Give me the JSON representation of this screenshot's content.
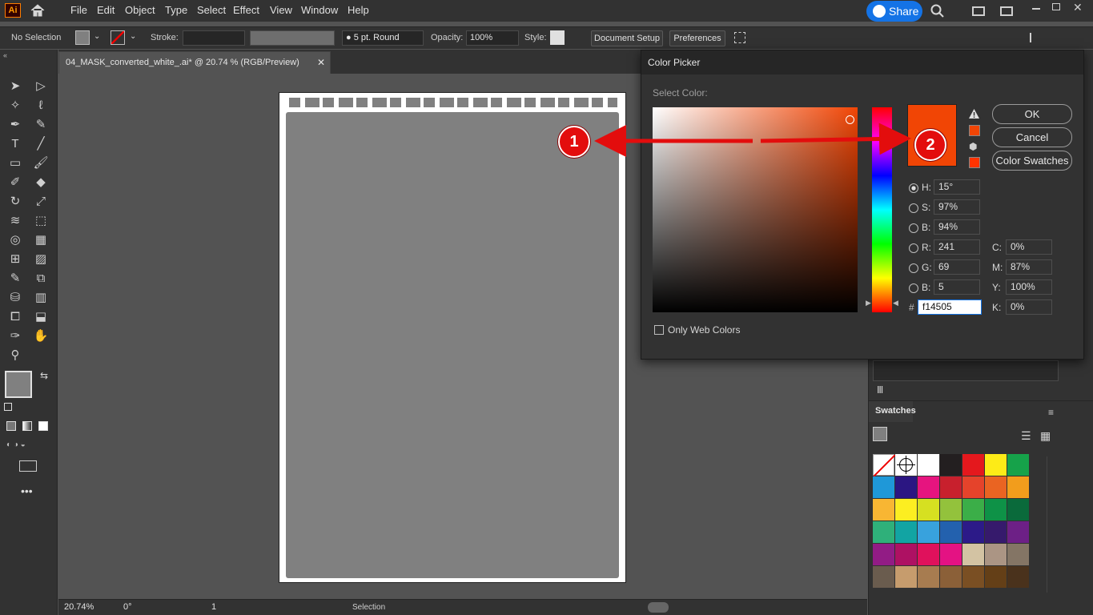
{
  "app": {
    "logo": "Ai",
    "share_label": "Share"
  },
  "menu": [
    "File",
    "Edit",
    "Object",
    "Type",
    "Select",
    "Effect",
    "View",
    "Window",
    "Help"
  ],
  "control": {
    "selection": "No Selection",
    "stroke_label": "Stroke:",
    "brush": "5 pt. Round",
    "opacity_label": "Opacity:",
    "opacity": "100%",
    "style_label": "Style:",
    "document_setup": "Document Setup",
    "preferences": "Preferences"
  },
  "document": {
    "tab_title": "04_MASK_converted_white_.ai* @ 20.74 % (RGB/Preview)"
  },
  "status": {
    "zoom": "20.74%",
    "rotation": "0°",
    "artboard": "1",
    "mode": "Selection"
  },
  "picker": {
    "title": "Color Picker",
    "select_label": "Select Color:",
    "ok": "OK",
    "cancel": "Cancel",
    "swatches": "Color Swatches",
    "h_label": "H:",
    "h": "15°",
    "s_label": "S:",
    "s": "97%",
    "b_label": "B:",
    "b": "94%",
    "r_label": "R:",
    "r": "241",
    "g_label": "G:",
    "g": "69",
    "bb_label": "B:",
    "bb": "5",
    "hash": "#",
    "hex": "f14505",
    "c_label": "C:",
    "c": "0%",
    "m_label": "M:",
    "m": "87%",
    "y_label": "Y:",
    "y": "100%",
    "k_label": "K:",
    "k": "0%",
    "web_only": "Only Web Colors",
    "selected_color": "#f14505"
  },
  "swatches_panel": {
    "title": "Swatches"
  },
  "annotations": {
    "badge1": "1",
    "badge2": "2"
  },
  "colors": {
    "fill": "#808080",
    "accent": "#1473e6",
    "annotation": "#e30d0d"
  }
}
